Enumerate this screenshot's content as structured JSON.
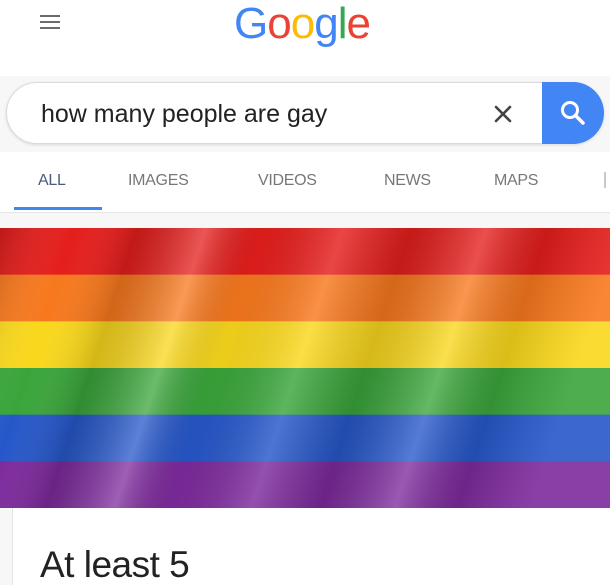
{
  "header": {
    "menu_icon": "hamburger-menu-icon",
    "logo_text": [
      "G",
      "o",
      "o",
      "g",
      "l",
      "e"
    ],
    "logo_colors": [
      "#4285f4",
      "#ea4335",
      "#fbbc05",
      "#4285f4",
      "#34a853",
      "#ea4335"
    ]
  },
  "search": {
    "query": "how many people are gay",
    "clear_icon": "close-icon",
    "search_icon": "search-icon",
    "button_color": "#4285f4"
  },
  "tabs": [
    {
      "label": "ALL",
      "active": true
    },
    {
      "label": "IMAGES",
      "active": false
    },
    {
      "label": "VIDEOS",
      "active": false
    },
    {
      "label": "NEWS",
      "active": false
    },
    {
      "label": "MAPS",
      "active": false
    }
  ],
  "result_image": {
    "description_icon": "rainbow-flag-image",
    "stripe_colors": [
      "#e41e1c",
      "#f7781d",
      "#f9d71c",
      "#3aa53a",
      "#2657c9",
      "#7d2a9c"
    ]
  },
  "answer": {
    "text": "At least 5"
  }
}
